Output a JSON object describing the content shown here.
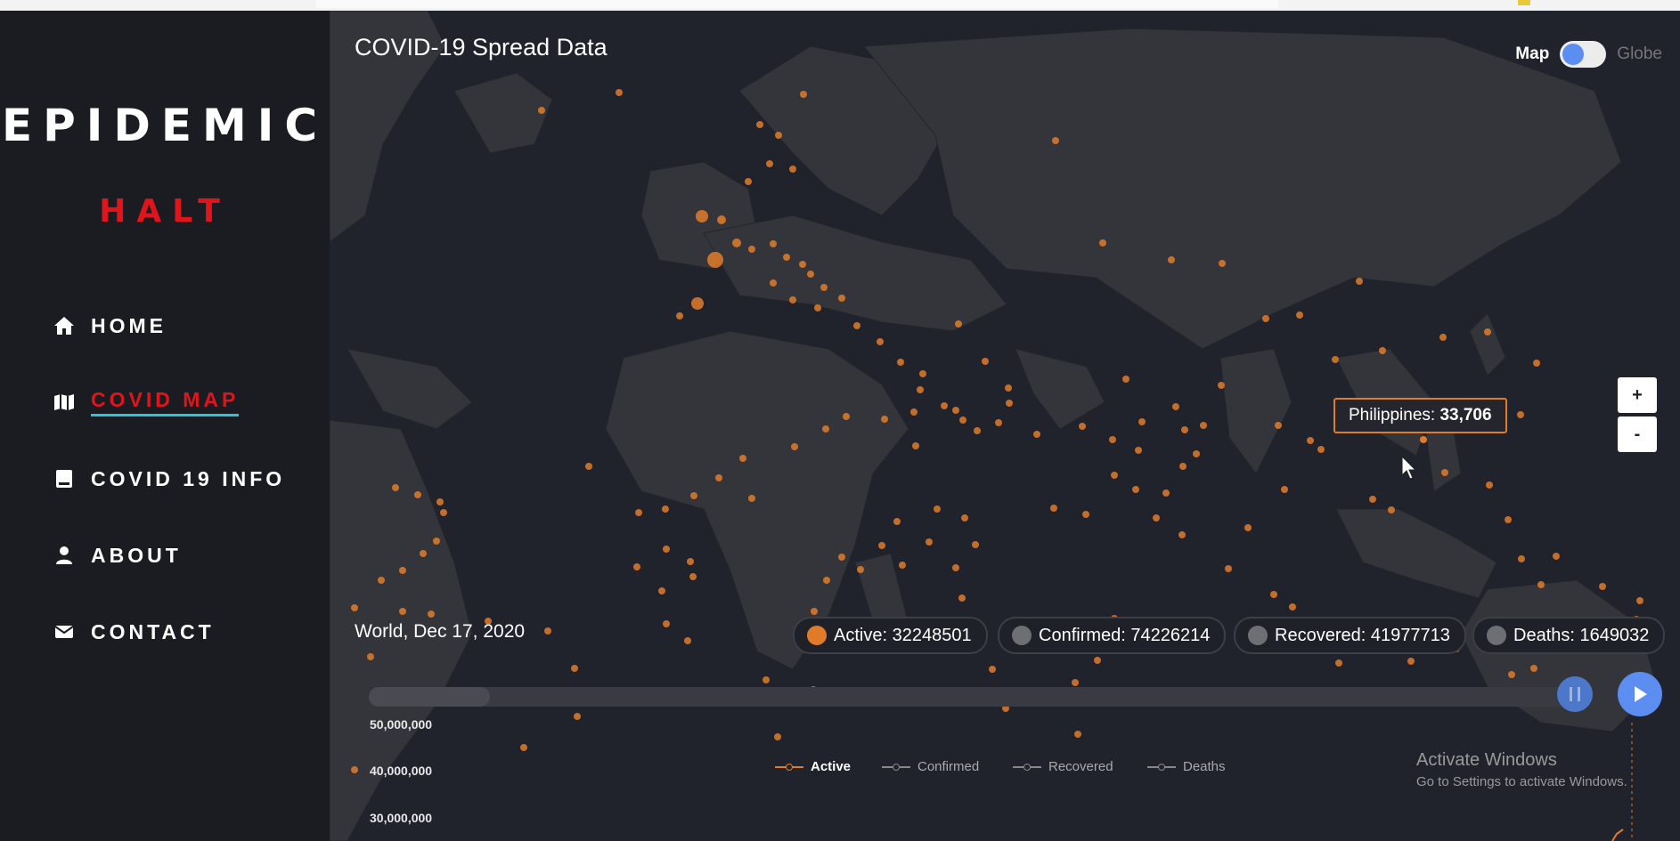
{
  "sidebar": {
    "logo_line1": "EPIDEMIC",
    "logo_line2": "HALT",
    "nav": [
      {
        "label": "HOME",
        "icon": "home-icon"
      },
      {
        "label": "COVID MAP",
        "icon": "map-icon",
        "active": true
      },
      {
        "label": "COVID 19 INFO",
        "icon": "book-icon"
      },
      {
        "label": "ABOUT",
        "icon": "user-icon"
      },
      {
        "label": "CONTACT",
        "icon": "envelope-icon"
      }
    ]
  },
  "map": {
    "title": "COVID-19 Spread Data",
    "toggle": {
      "left": "Map",
      "right": "Globe"
    },
    "zoom_in": "+",
    "zoom_out": "-",
    "tooltip": {
      "country": "Philippines:",
      "value": "33,706"
    },
    "location_date": "World, Dec 17, 2020",
    "stats": [
      {
        "label": "Active: 32248501",
        "color": "#e07b2a"
      },
      {
        "label": "Confirmed: 74226214",
        "color": "#6e6f74"
      },
      {
        "label": "Recovered: 41977713",
        "color": "#6e6f74"
      },
      {
        "label": "Deaths: 1649032",
        "color": "#6e6f74"
      }
    ],
    "timeline_progress": 0.1
  },
  "chart": {
    "yticks": [
      "50,000,000",
      "40,000,000",
      "30,000,000"
    ],
    "legend": [
      "Active",
      "Confirmed",
      "Recovered",
      "Deaths"
    ]
  },
  "watermark": {
    "title": "Activate Windows",
    "subtitle": "Go to Settings to activate Windows."
  },
  "colors": {
    "accent": "#e07b2a",
    "brand_red": "#e0141b",
    "toggle_blue": "#5b8ef0"
  }
}
